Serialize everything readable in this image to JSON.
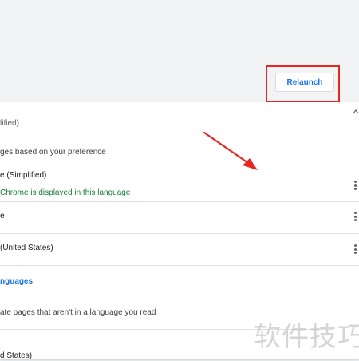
{
  "languages_section": {
    "header_text": "lified)",
    "order_hint": "ges based on your preference",
    "items": [
      {
        "name": "e (Simplified)",
        "subtitle": "Chrome is displayed in this language",
        "action_label": "Relaunch"
      },
      {
        "name": "e"
      },
      {
        "name": "(United States)"
      }
    ],
    "add_languages_label": "nguages",
    "offer_translate_text": "ate pages that aren't in a language you read",
    "next_item_text": "d States)"
  },
  "colors": {
    "accent": "#1a73e8",
    "success_text": "#188038",
    "annotation_red": "#e8251f"
  },
  "icons": {
    "more": "more-vert-icon",
    "collapse": "chevron-up-icon"
  },
  "watermark": {
    "text": "软件技巧"
  }
}
